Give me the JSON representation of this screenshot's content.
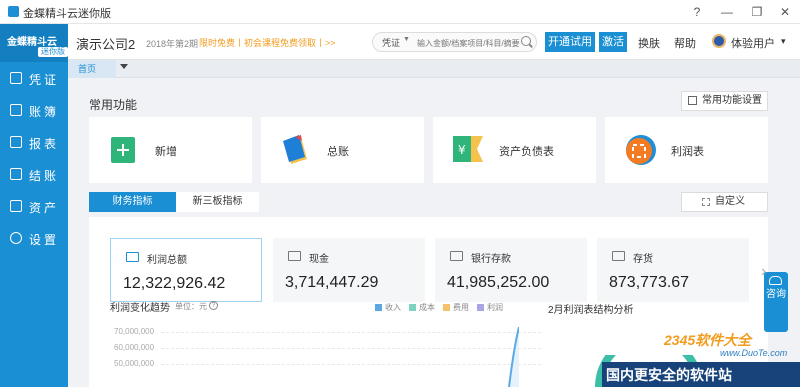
{
  "titlebar": {
    "title": "金蝶精斗云迷你版",
    "help": "?",
    "minimize": "—",
    "maximize": "❐",
    "close": "✕"
  },
  "sidebar": {
    "brand": "金蝶精斗云",
    "badge": "迷你版",
    "items": [
      {
        "label": "凭证",
        "icon": "voucher-icon"
      },
      {
        "label": "账簿",
        "icon": "ledger-icon"
      },
      {
        "label": "报表",
        "icon": "report-icon"
      },
      {
        "label": "结账",
        "icon": "checkout-icon"
      },
      {
        "label": "资产",
        "icon": "asset-icon"
      },
      {
        "label": "设置",
        "icon": "gear-icon"
      }
    ]
  },
  "header": {
    "company": "演示公司2",
    "period": "2018年第2期",
    "promo": "限时免费丨初会课程免费领取丨>>",
    "search_type": "凭证",
    "search_placeholder": "输入金额/档案项目/科目/摘要",
    "trial_button": "开通试用",
    "activate_button": "激活",
    "skin": "换肤",
    "help": "帮助",
    "user": "体验用户",
    "user_caret": "▾"
  },
  "tabs": {
    "home": "首页"
  },
  "common": {
    "title": "常用功能",
    "settings_button": "常用功能设置",
    "cards": [
      {
        "label": "新增",
        "icon": "add-icon",
        "color": "#2fb47a"
      },
      {
        "label": "总账",
        "icon": "general-ledger-icon",
        "color": "#1e7fd6"
      },
      {
        "label": "资产负债表",
        "icon": "balance-sheet-icon",
        "color": "#2fb47a"
      },
      {
        "label": "利润表",
        "icon": "profit-statement-icon",
        "color": "#f57b23"
      }
    ]
  },
  "indicator_tabs": {
    "active": "财务指标",
    "inactive": "新三板指标",
    "custom_button": "自定义"
  },
  "metrics": [
    {
      "label": "利润总额",
      "value": "12,322,926.42"
    },
    {
      "label": "现金",
      "value": "3,714,447.29"
    },
    {
      "label": "银行存款",
      "value": "41,985,252.00"
    },
    {
      "label": "存货",
      "value": "873,773.67"
    }
  ],
  "trend": {
    "title": "利润变化趋势",
    "unit": "单位：元",
    "help": "?",
    "legend": [
      {
        "name": "收入",
        "color": "#5aa9e6"
      },
      {
        "name": "成本",
        "color": "#7fd1c0"
      },
      {
        "name": "费用",
        "color": "#f5c26b"
      },
      {
        "name": "利润",
        "color": "#a9a4e6"
      }
    ],
    "y_ticks": [
      "70,000,000",
      "60,000,000",
      "50,000,000"
    ]
  },
  "pie": {
    "title": "2月利润表结构分析"
  },
  "consult": {
    "label": "咨询"
  },
  "watermark": {
    "brand": "2345软件大全",
    "url": "www.DuoTe.com",
    "slogan": "国内更安全的软件站"
  },
  "colors": {
    "primary": "#1b8fd3",
    "promo": "#f29c1f"
  }
}
